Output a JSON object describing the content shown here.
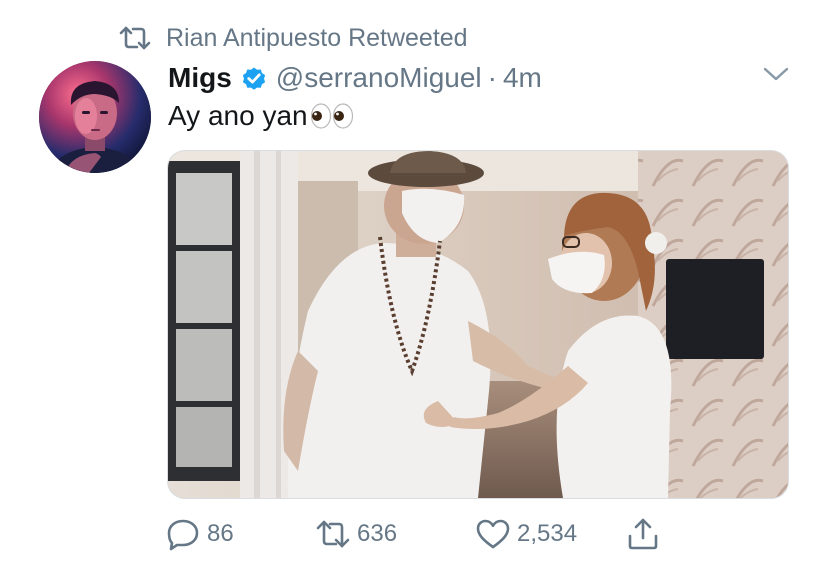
{
  "retweet_banner": {
    "text": "Rian Antipuesto Retweeted",
    "icon": "retweet-icon"
  },
  "tweet": {
    "display_name": "Migs",
    "verified": true,
    "handle": "@serranoMiguel",
    "separator": "·",
    "time": "4m",
    "text": "Ay ano yan",
    "emoji": "eyes-emoji",
    "media": "photo"
  },
  "actions": {
    "reply_count": "86",
    "retweet_count": "636",
    "like_count": "2,534"
  },
  "colors": {
    "text_primary": "#14171a",
    "text_secondary": "#657786",
    "verified_blue": "#1da1f2"
  }
}
